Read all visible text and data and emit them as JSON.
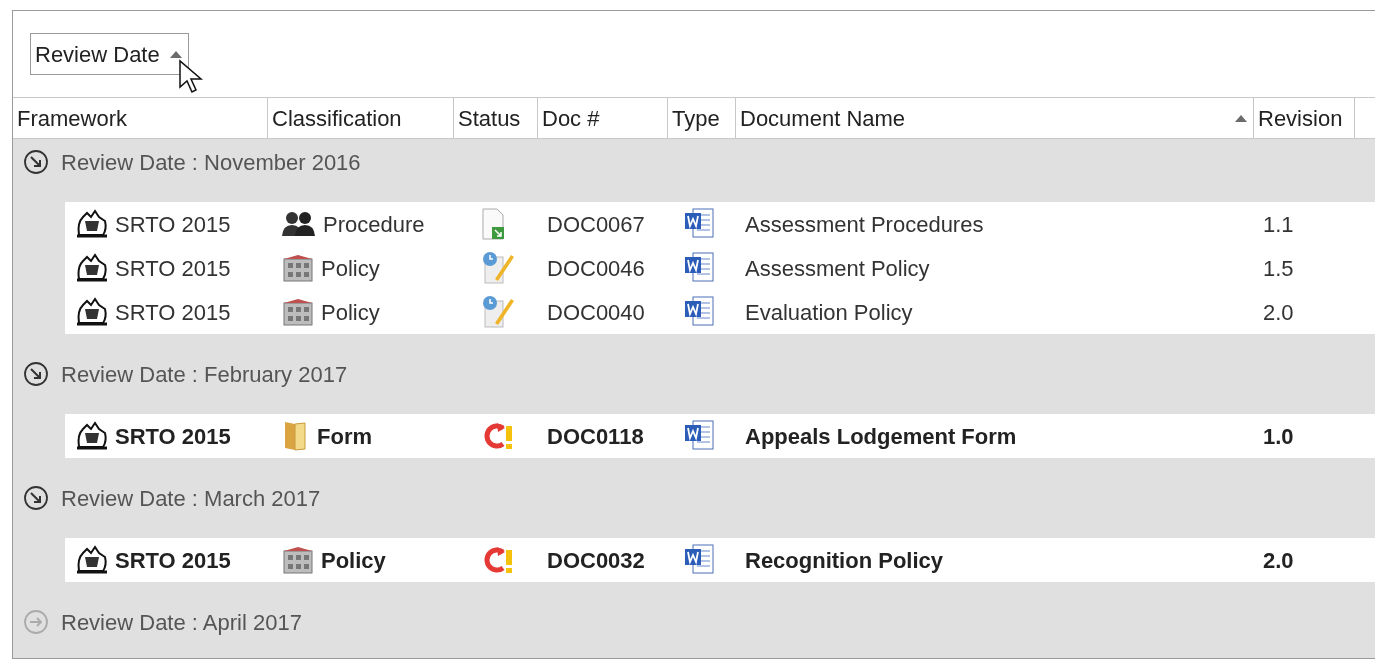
{
  "group_panel": {
    "chips": [
      {
        "label": "Review Date",
        "sorted": true
      }
    ]
  },
  "columns": [
    {
      "label": "Framework",
      "sorted": false
    },
    {
      "label": "Classification",
      "sorted": false
    },
    {
      "label": "Status",
      "sorted": false
    },
    {
      "label": "Doc #",
      "sorted": false
    },
    {
      "label": "Type",
      "sorted": false
    },
    {
      "label": "Document Name",
      "sorted": true
    },
    {
      "label": "Revision",
      "sorted": false
    }
  ],
  "groups": [
    {
      "label": "Review Date : November 2016",
      "expanded": true,
      "rows": [
        {
          "framework": "SRTO 2015",
          "classification": {
            "label": "Procedure",
            "kind": "people"
          },
          "status": {
            "kind": "new"
          },
          "doc": "DOC0067",
          "name": "Assessment Procedures",
          "revision": "1.1",
          "bold": false
        },
        {
          "framework": "SRTO 2015",
          "classification": {
            "label": "Policy",
            "kind": "building"
          },
          "status": {
            "kind": "pending"
          },
          "doc": "DOC0046",
          "name": "Assessment Policy",
          "revision": "1.5",
          "bold": false
        },
        {
          "framework": "SRTO 2015",
          "classification": {
            "label": "Policy",
            "kind": "building"
          },
          "status": {
            "kind": "pending"
          },
          "doc": "DOC0040",
          "name": "Evaluation Policy",
          "revision": "2.0",
          "bold": false
        }
      ]
    },
    {
      "label": "Review Date : February 2017",
      "expanded": true,
      "rows": [
        {
          "framework": "SRTO 2015",
          "classification": {
            "label": "Form",
            "kind": "folder"
          },
          "status": {
            "kind": "overdue"
          },
          "doc": "DOC0118",
          "name": "Appeals Lodgement Form",
          "revision": "1.0",
          "bold": true
        }
      ]
    },
    {
      "label": "Review Date : March 2017",
      "expanded": true,
      "rows": [
        {
          "framework": "SRTO 2015",
          "classification": {
            "label": "Policy",
            "kind": "building"
          },
          "status": {
            "kind": "overdue"
          },
          "doc": "DOC0032",
          "name": "Recognition Policy",
          "revision": "2.0",
          "bold": true
        }
      ]
    },
    {
      "label": "Review Date : April 2017",
      "expanded": false
    }
  ]
}
